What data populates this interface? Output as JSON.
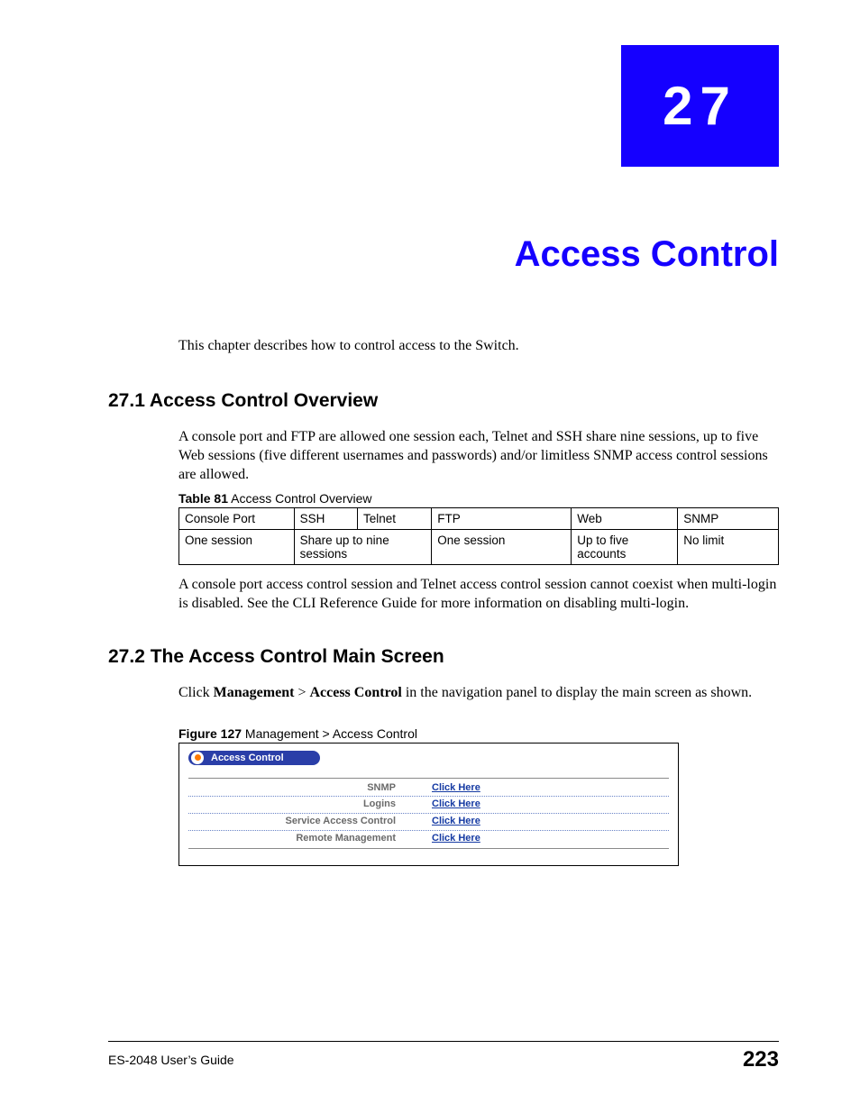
{
  "chapter": {
    "number": "27",
    "title": "Access Control"
  },
  "intro": "This chapter describes how to control access to the Switch.",
  "section1": {
    "heading": "27.1  Access Control Overview",
    "body1": "A console port and FTP are allowed one session each, Telnet and SSH share nine sessions, up to five Web sessions (five different usernames and passwords) and/or limitless SNMP access control sessions are allowed.",
    "table_caption_bold": "Table 81",
    "table_caption_rest": "   Access Control Overview",
    "headers": {
      "console": "Console Port",
      "ssh": "SSH",
      "telnet": "Telnet",
      "ftp": "FTP",
      "web": "Web",
      "snmp": "SNMP"
    },
    "row": {
      "console": "One session",
      "sshtelnet": "Share up to nine sessions",
      "ftp": "One session",
      "web": "Up to five accounts",
      "snmp": "No limit"
    },
    "body2": "A console port access control session and Telnet access control session cannot coexist when multi-login is disabled. See the CLI Reference Guide for more information on disabling multi-login."
  },
  "section2": {
    "heading": "27.2  The Access Control Main Screen",
    "body_pre": "Click ",
    "nav1": "Management",
    "sep": " > ",
    "nav2": "Access Control",
    "body_post": " in the navigation panel to display the main screen as shown.",
    "fig_caption_bold": "Figure 127",
    "fig_caption_rest": "   Management > Access Control",
    "pill": "Access Control",
    "rows": [
      {
        "label": "SNMP",
        "link": "Click Here"
      },
      {
        "label": "Logins",
        "link": "Click Here"
      },
      {
        "label": "Service Access Control",
        "link": "Click Here"
      },
      {
        "label": "Remote Management",
        "link": "Click Here"
      }
    ]
  },
  "footer": {
    "left": "ES-2048 User’s Guide",
    "right": "223"
  }
}
